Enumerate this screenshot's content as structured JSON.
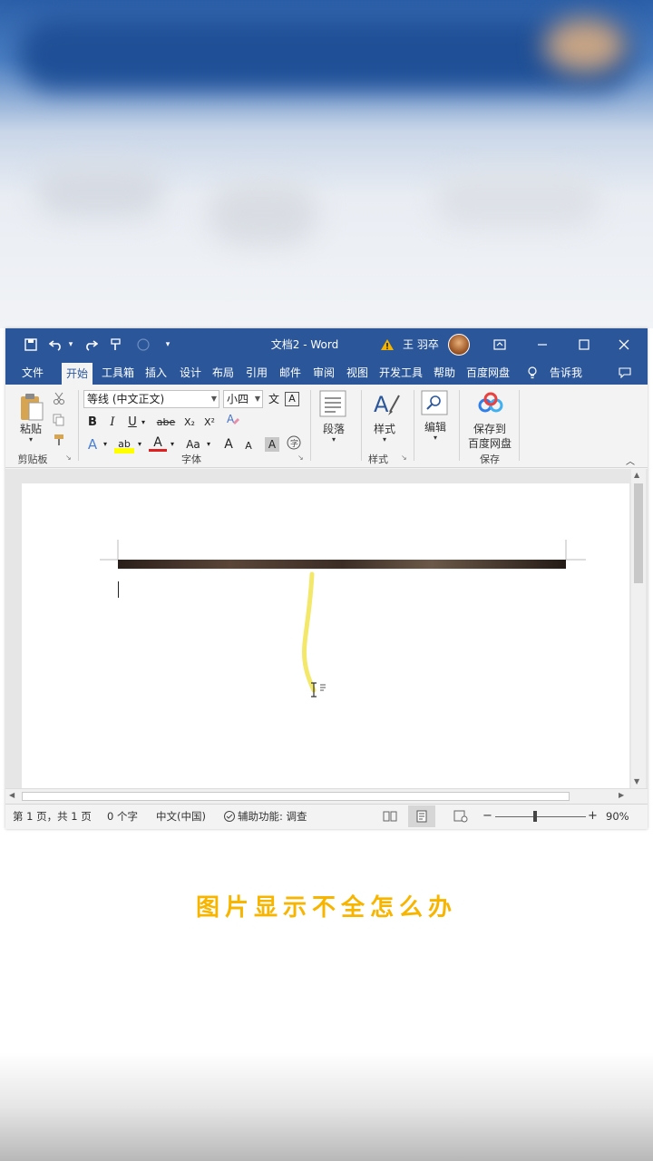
{
  "window": {
    "title": "文档2 - Word",
    "user_name": "王 羽卒",
    "warning_icon": "warning-icon",
    "accent_color": "#2b579a"
  },
  "tabs": [
    "文件",
    "开始",
    "工具箱",
    "插入",
    "设计",
    "布局",
    "引用",
    "邮件",
    "审阅",
    "视图",
    "开发工具",
    "帮助",
    "百度网盘",
    "告诉我"
  ],
  "active_tab": "开始",
  "ribbon": {
    "clipboard": {
      "paste_label": "粘贴",
      "group_label": "剪贴板"
    },
    "font": {
      "font_name": "等线 (中文正文)",
      "font_size": "小四",
      "group_label": "字体",
      "bold": "B",
      "italic": "I",
      "underline": "U",
      "strike": "abe",
      "subscript": "X₂",
      "superscript": "X²",
      "grow": "A",
      "shrink": "A",
      "case": "Aa",
      "char_shading": "A",
      "font_color": "A",
      "highlight": "ab",
      "text_effect": "A",
      "clear": "A",
      "phonetic": "文",
      "enclose": "A",
      "circle": "字"
    },
    "paragraph": {
      "label": "段落"
    },
    "styles": {
      "label": "样式",
      "group_label": "样式"
    },
    "editing": {
      "label": "编辑"
    },
    "save": {
      "label_line1": "保存到",
      "label_line2": "百度网盘",
      "group_label": "保存"
    }
  },
  "status": {
    "page": "第 1 页，共 1 页",
    "words": "0 个字",
    "language": "中文(中国)",
    "accessibility": "辅助功能: 调查",
    "zoom": "90%",
    "zoom_minus": "−",
    "zoom_plus": "+"
  },
  "caption": "图片显示不全怎么办"
}
